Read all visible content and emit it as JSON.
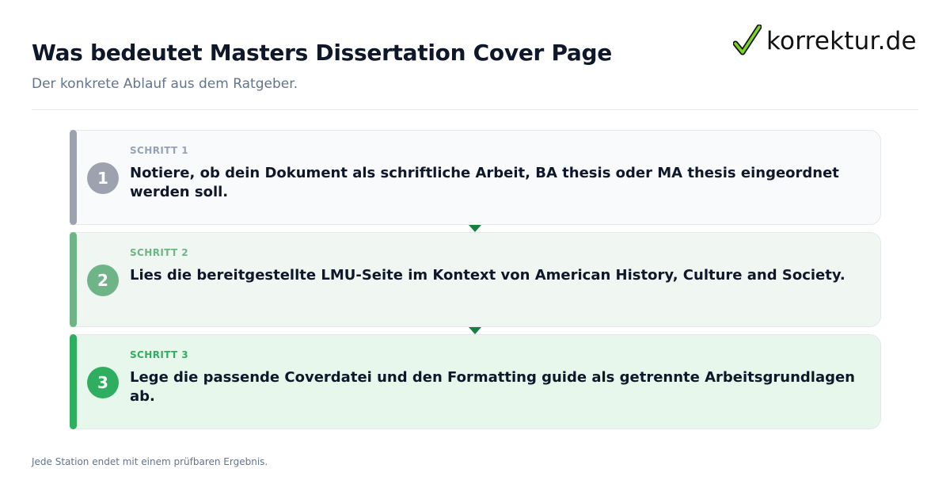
{
  "header": {
    "title": "Was bedeutet Masters Dissertation Cover Page",
    "subtitle": "Der konkrete Ablauf aus dem Ratgeber."
  },
  "logo": {
    "icon": "checkmark-icon",
    "text": "korrektur.de"
  },
  "steps": [
    {
      "number": "1",
      "label": "SCHRITT 1",
      "text": "Notiere, ob dein Dokument als schriftliche Arbeit, BA thesis oder MA thesis eingeordnet werden soll.",
      "accent": "#9ca3af",
      "label_color": "#94a3b8",
      "background": "#f8fafc"
    },
    {
      "number": "2",
      "label": "SCHRITT 2",
      "text": "Lies die bereitgestellte LMU-Seite im Kontext von American History, Culture and Society.",
      "accent": "#6fb487",
      "label_color": "#6fb487",
      "background": "#f0f6f1"
    },
    {
      "number": "3",
      "label": "SCHRITT 3",
      "text": "Lege die passende Coverdatei und den Formatting guide als getrennte Arbeitsgrundlagen ab.",
      "accent": "#2fae5f",
      "label_color": "#2fae5f",
      "background": "#e8f7ec"
    }
  ],
  "connector_color": "#15803d",
  "footer": {
    "note": "Jede Station endet mit einem prüfbaren Ergebnis."
  }
}
